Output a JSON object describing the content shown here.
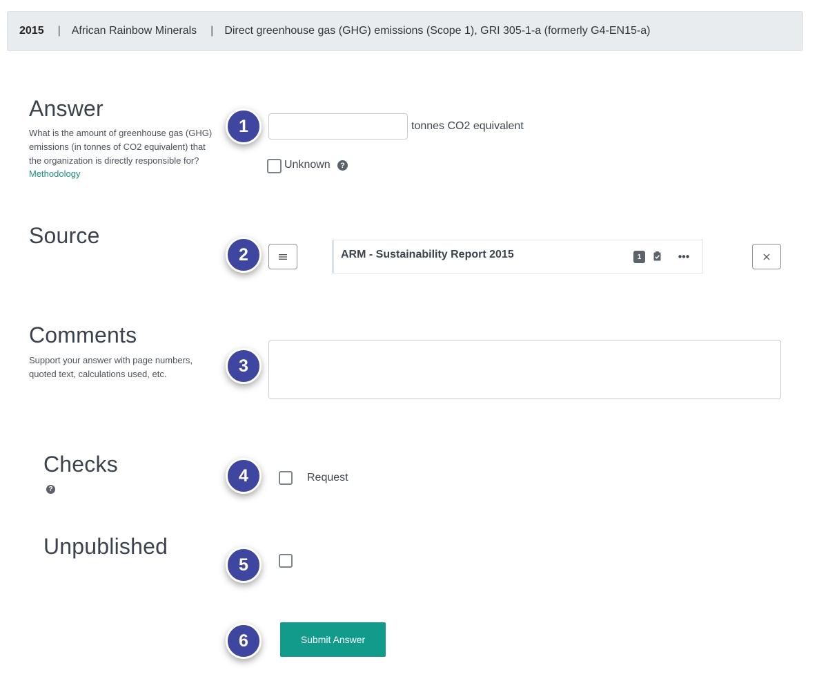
{
  "header": {
    "year": "2015",
    "sep": "|",
    "company": "African Rainbow Minerals",
    "indicator": "Direct greenhouse gas (GHG) emissions (Scope 1), GRI 305-1-a (formerly G4-EN15-a)"
  },
  "answer": {
    "title": "Answer",
    "description": "What is the amount of greenhouse gas (GHG) emissions (in tonnes of CO2 equivalent) that the organization is directly responsible for?",
    "methodology_link": "Methodology",
    "value": "",
    "unit": "tonnes CO2 equivalent",
    "unknown_label": "Unknown"
  },
  "source": {
    "title": "Source",
    "document_title": "ARM - Sustainability Report 2015",
    "page_count": "1"
  },
  "comments": {
    "title": "Comments",
    "description": "Support your answer with page numbers, quoted text, calculations used, etc.",
    "value": ""
  },
  "checks": {
    "title": "Checks",
    "request_label": "Request"
  },
  "unpublished": {
    "title": "Unpublished"
  },
  "submit": {
    "label": "Submit Answer"
  },
  "badges": [
    "1",
    "2",
    "3",
    "4",
    "5",
    "6"
  ],
  "icons": {
    "help": "question-circle-icon",
    "list": "list-icon",
    "clipboard": "clipboard-check-icon",
    "more": "ellipsis-icon",
    "close": "close-icon"
  },
  "colors": {
    "badge": "#3f46a0",
    "accent": "#129a8a",
    "link": "#1a8f7e",
    "header_bg": "#e9ecef"
  }
}
